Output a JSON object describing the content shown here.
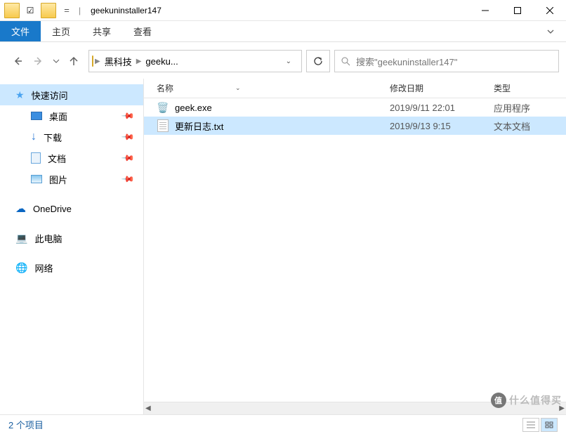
{
  "window": {
    "title": "geekuninstaller147"
  },
  "ribbon": {
    "file": "文件",
    "tabs": [
      "主页",
      "共享",
      "查看"
    ]
  },
  "breadcrumb": {
    "items": [
      "黑科技",
      "geeku..."
    ]
  },
  "search": {
    "placeholder": "搜索\"geekuninstaller147\""
  },
  "sidebar": {
    "quick": "快速访问",
    "items": [
      {
        "label": "桌面",
        "pin": true
      },
      {
        "label": "下载",
        "pin": true
      },
      {
        "label": "文档",
        "pin": true
      },
      {
        "label": "图片",
        "pin": true
      }
    ],
    "onedrive": "OneDrive",
    "thispc": "此电脑",
    "network": "网络"
  },
  "columns": {
    "name": "名称",
    "date": "修改日期",
    "type": "类型"
  },
  "files": [
    {
      "name": "geek.exe",
      "date": "2019/9/11 22:01",
      "type": "应用程序",
      "selected": false,
      "icon": "exe"
    },
    {
      "name": "更新日志.txt",
      "date": "2019/9/13 9:15",
      "type": "文本文档",
      "selected": true,
      "icon": "txt"
    }
  ],
  "status": {
    "count": "2 个项目"
  },
  "watermark": "什么值得买"
}
